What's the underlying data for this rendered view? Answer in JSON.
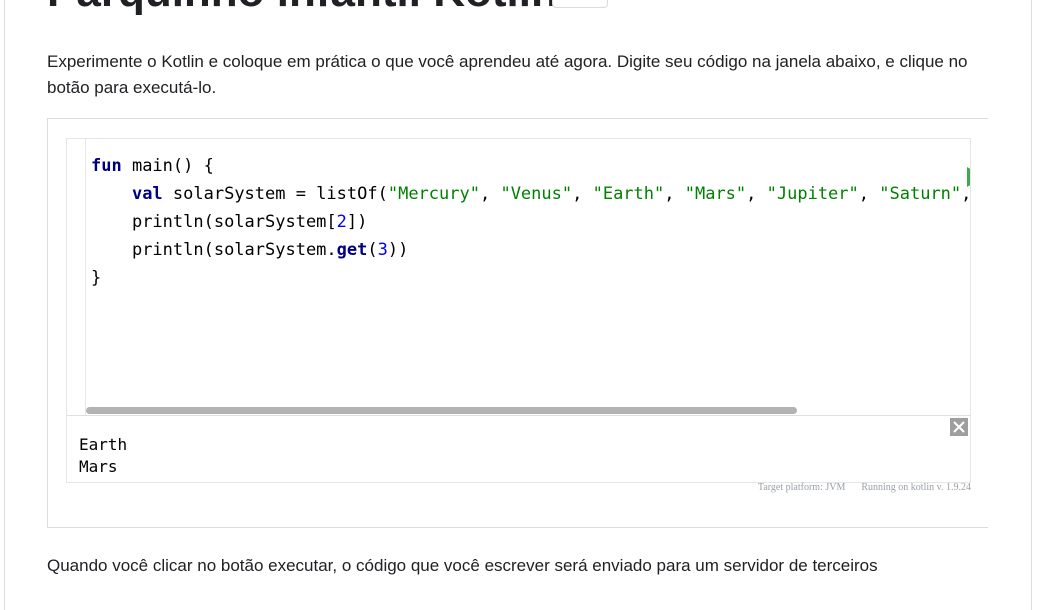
{
  "page": {
    "title": "Parquinho infantil Kotlin",
    "intro": "Experimente o Kotlin e coloque em prática o que você aprendeu até agora. Digite seu código na janela abaixo, e clique no botão para executá-lo.",
    "disclaimer_line1": "Quando você clicar no botão executar, o código que você escrever será enviado para um servidor de terceiros"
  },
  "playground": {
    "code": {
      "l1": {
        "kw": "fun",
        "rest": " main() {"
      },
      "l2": {
        "kw": "val",
        "decl": " solarSystem = listOf(",
        "s1": "\"Mercury\"",
        "s2": "\"Venus\"",
        "s3": "\"Earth\"",
        "s4": "\"Mars\"",
        "s5": "\"Jupiter\"",
        "s6": "\"Saturn\""
      },
      "l3": {
        "pre": "println(solarSystem[",
        "num": "2",
        "post": "])"
      },
      "l4": {
        "pre": "println(solarSystem.",
        "method": "get",
        "open": "(",
        "num": "3",
        "post": "))"
      },
      "l5": "}"
    },
    "output": [
      "Earth",
      "Mars"
    ],
    "target_platform": "Target platform: JVM",
    "running_on": "Running on kotlin v. 1.9.24",
    "run_icon": "play-icon",
    "close_icon": "close-icon",
    "colors": {
      "run": "#3eaa4d",
      "keyword": "#000080",
      "string": "#008000",
      "number": "#0000ff"
    }
  }
}
